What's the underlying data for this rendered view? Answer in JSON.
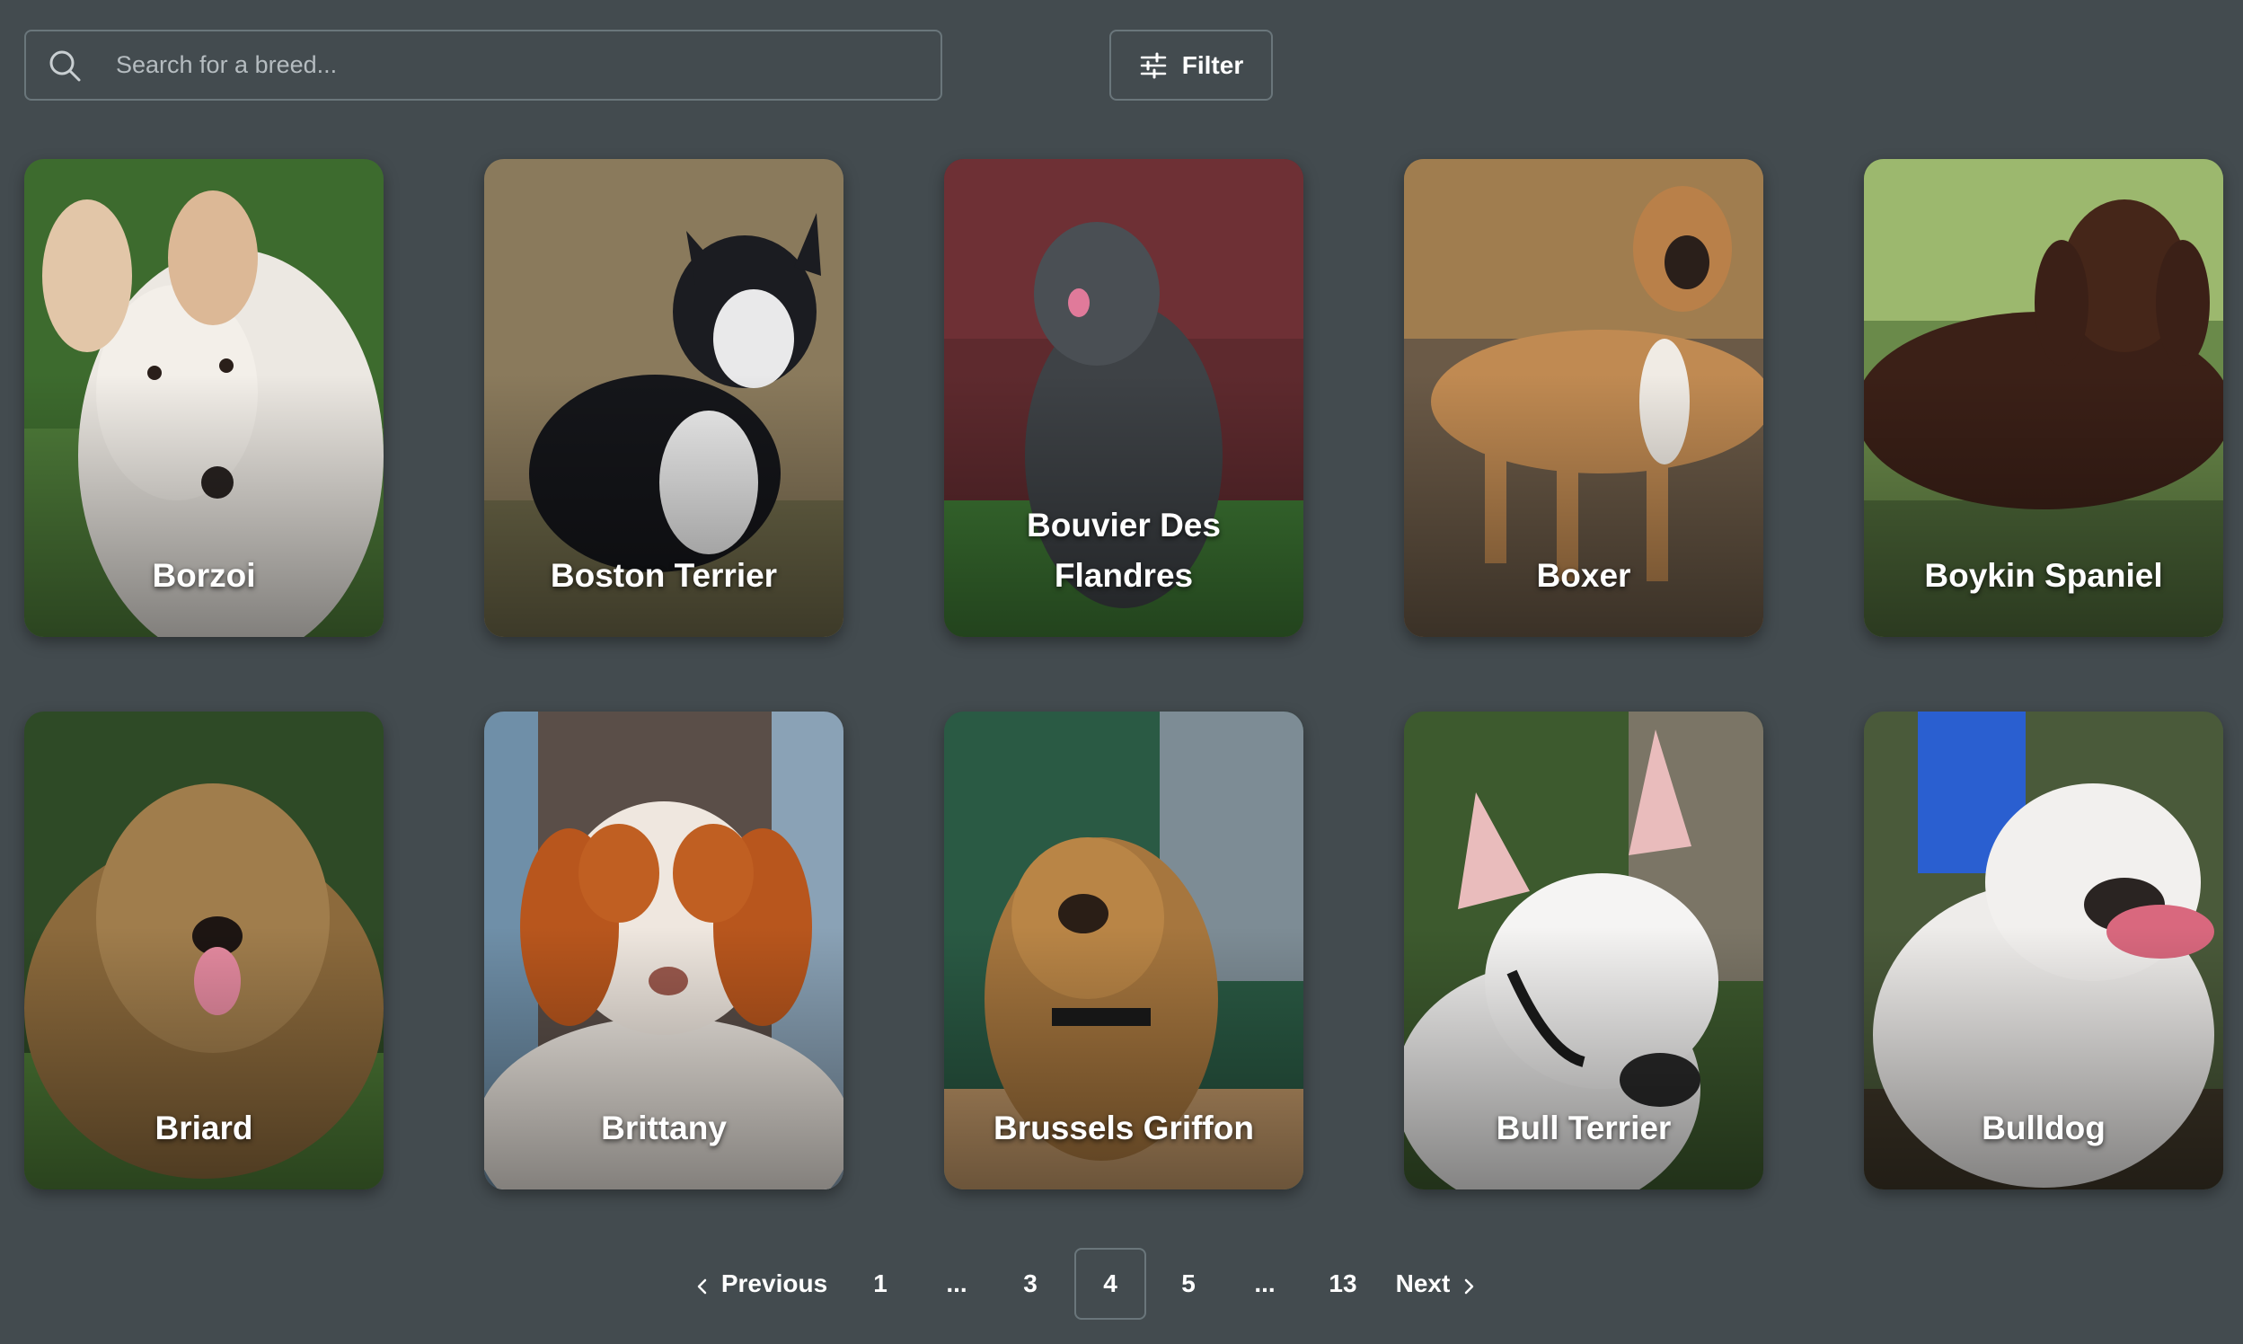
{
  "search": {
    "placeholder": "Search for a breed..."
  },
  "filter": {
    "label": "Filter"
  },
  "breeds": [
    {
      "name": "Borzoi"
    },
    {
      "name": "Boston Terrier"
    },
    {
      "name": "Bouvier Des Flandres"
    },
    {
      "name": "Boxer"
    },
    {
      "name": "Boykin Spaniel"
    },
    {
      "name": "Briard"
    },
    {
      "name": "Brittany"
    },
    {
      "name": "Brussels Griffon"
    },
    {
      "name": "Bull Terrier"
    },
    {
      "name": "Bulldog"
    }
  ],
  "pagination": {
    "previous_label": "Previous",
    "next_label": "Next",
    "pages": [
      "1",
      "...",
      "3",
      "4",
      "5",
      "...",
      "13"
    ],
    "current": "4"
  },
  "colors": {
    "background": "#434b4f",
    "border": "#6a767b",
    "text": "#ffffff"
  }
}
